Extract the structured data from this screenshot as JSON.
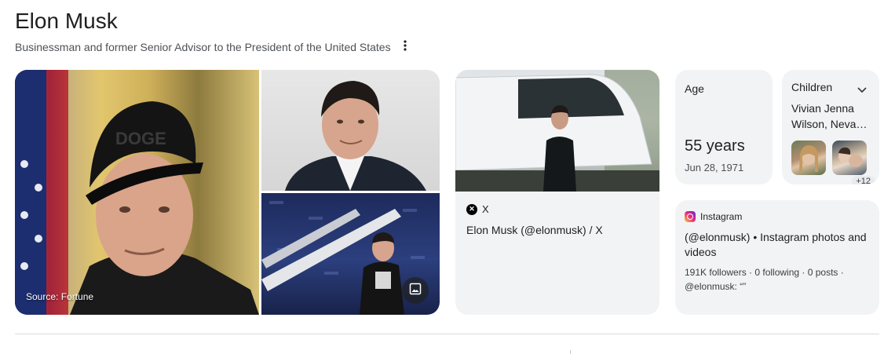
{
  "header": {
    "title": "Elon Musk",
    "subtitle": "Businessman and former Senior Advisor to the President of the United States",
    "more_icon": "more-vert-icon"
  },
  "gallery": {
    "source_label": "Source: Fortune",
    "image_icon": "image-icon"
  },
  "x_card": {
    "source_name": "X",
    "title": "Elon Musk (@elonmusk) / X"
  },
  "age_card": {
    "label": "Age",
    "value": "55 years",
    "birth_date": "Jun 28, 1971"
  },
  "children_card": {
    "label": "Children",
    "names": "Vivian Jenna Wilson, Neva…",
    "more_count": "+12",
    "chevron_icon": "chevron-down-icon"
  },
  "instagram_card": {
    "source_name": "Instagram",
    "title": "(@elonmusk) • Instagram photos and videos",
    "stats": "191K followers · 0 following · 0 posts ·",
    "bio": "@elonmusk: “”"
  },
  "colors": {
    "text_primary": "#1f1f1f",
    "text_secondary": "#4d5156",
    "card_bg": "#f1f3f4",
    "divider": "#dadce0"
  }
}
